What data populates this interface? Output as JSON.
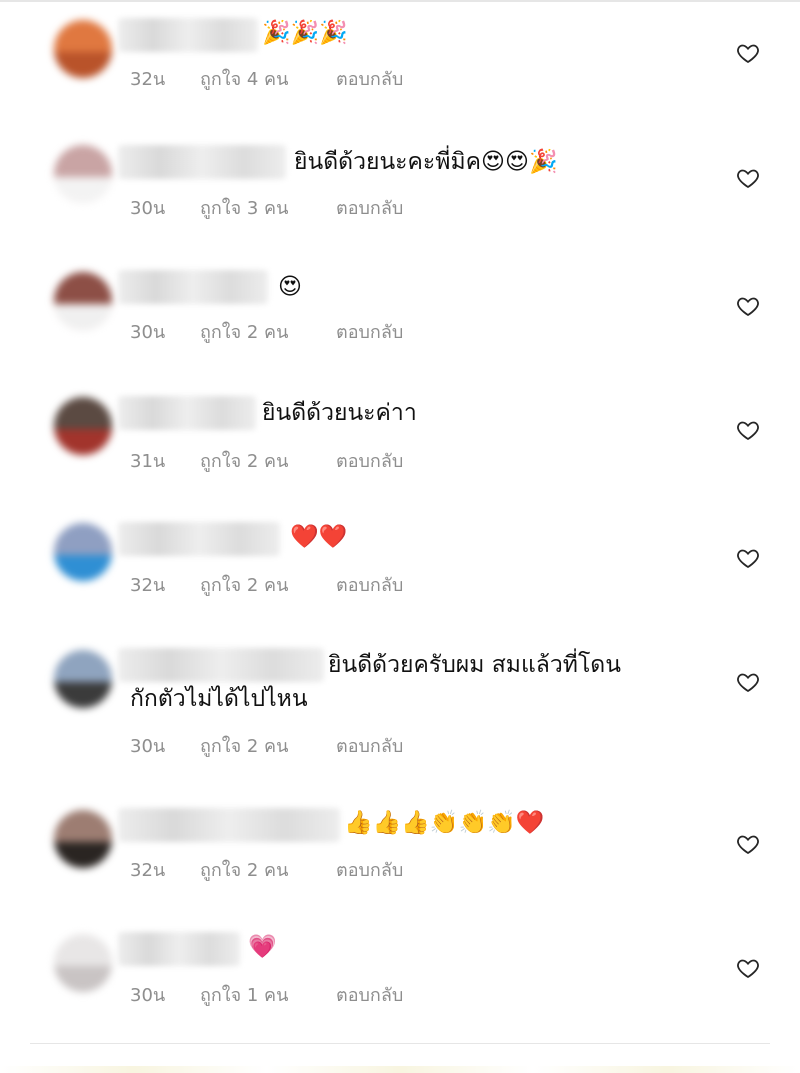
{
  "comments": [
    {
      "text": "🎉🎉🎉",
      "time": "32น",
      "likes": "ถูกใจ 4 คน",
      "reply": "ตอบกลับ",
      "avatar_color": "#e07840",
      "avatar_fg": "#b9532a"
    },
    {
      "text": "ยินดีด้วยนะคะพี่มิค😍😍🎉",
      "time": "30น",
      "likes": "ถูกใจ 3 คน",
      "reply": "ตอบกลับ",
      "avatar_color": "#c9a4a4",
      "avatar_fg": "#f3f3f3"
    },
    {
      "text": "😍",
      "time": "30น",
      "likes": "ถูกใจ 2 คน",
      "reply": "ตอบกลับ",
      "avatar_color": "#8d4f46",
      "avatar_fg": "#f0f0f0"
    },
    {
      "text": "ยินดีด้วยนะค่าา",
      "time": "31น",
      "likes": "ถูกใจ 2 คน",
      "reply": "ตอบกลับ",
      "avatar_color": "#5b4a42",
      "avatar_fg": "#a2342c"
    },
    {
      "text": "❤️❤️",
      "time": "32น",
      "likes": "ถูกใจ 2 คน",
      "reply": "ตอบกลับ",
      "avatar_color": "#8f9fc2",
      "avatar_fg": "#2f8fd4"
    },
    {
      "text": "ยินดีด้วยครับผม สมแล้วที่โดน",
      "text_line2": "กักตัวไม่ได้ไปไหน",
      "time": "30น",
      "likes": "ถูกใจ 2 คน",
      "reply": "ตอบกลับ",
      "avatar_color": "#8fa4bf",
      "avatar_fg": "#3b3b3b"
    },
    {
      "text": "👍👍👍👏👏👏❤️",
      "time": "32น",
      "likes": "ถูกใจ 2 คน",
      "reply": "ตอบกลับ",
      "avatar_color": "#9d7d72",
      "avatar_fg": "#2a2522"
    },
    {
      "text": "💗",
      "time": "30น",
      "likes": "ถูกใจ 1 คน",
      "reply": "ตอบกลับ",
      "avatar_color": "#e8e6e6",
      "avatar_fg": "#c9c4c4"
    }
  ],
  "icons": {
    "like": "heart-outline-icon"
  }
}
